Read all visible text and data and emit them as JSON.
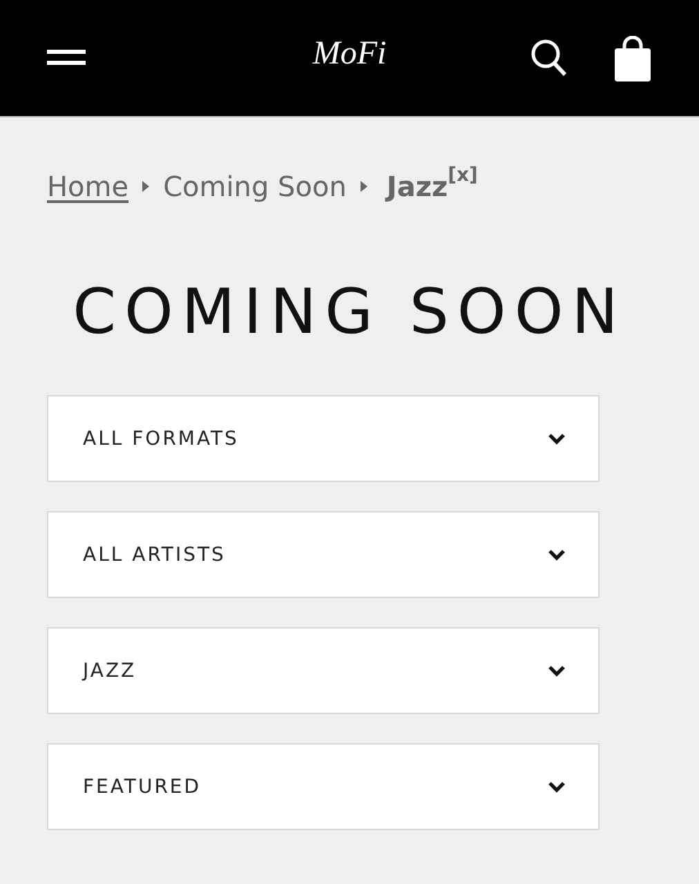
{
  "header": {
    "logo": "MoFi"
  },
  "breadcrumb": {
    "items": [
      {
        "label": "Home",
        "kind": "link"
      },
      {
        "label": "Coming Soon",
        "kind": "plain"
      },
      {
        "label": "Jazz",
        "kind": "current"
      }
    ],
    "remove": "[x]"
  },
  "title": "COMING SOON",
  "filters": [
    {
      "label": "ALL FORMATS"
    },
    {
      "label": "ALL ARTISTS"
    },
    {
      "label": "JAZZ"
    },
    {
      "label": "FEATURED"
    }
  ]
}
